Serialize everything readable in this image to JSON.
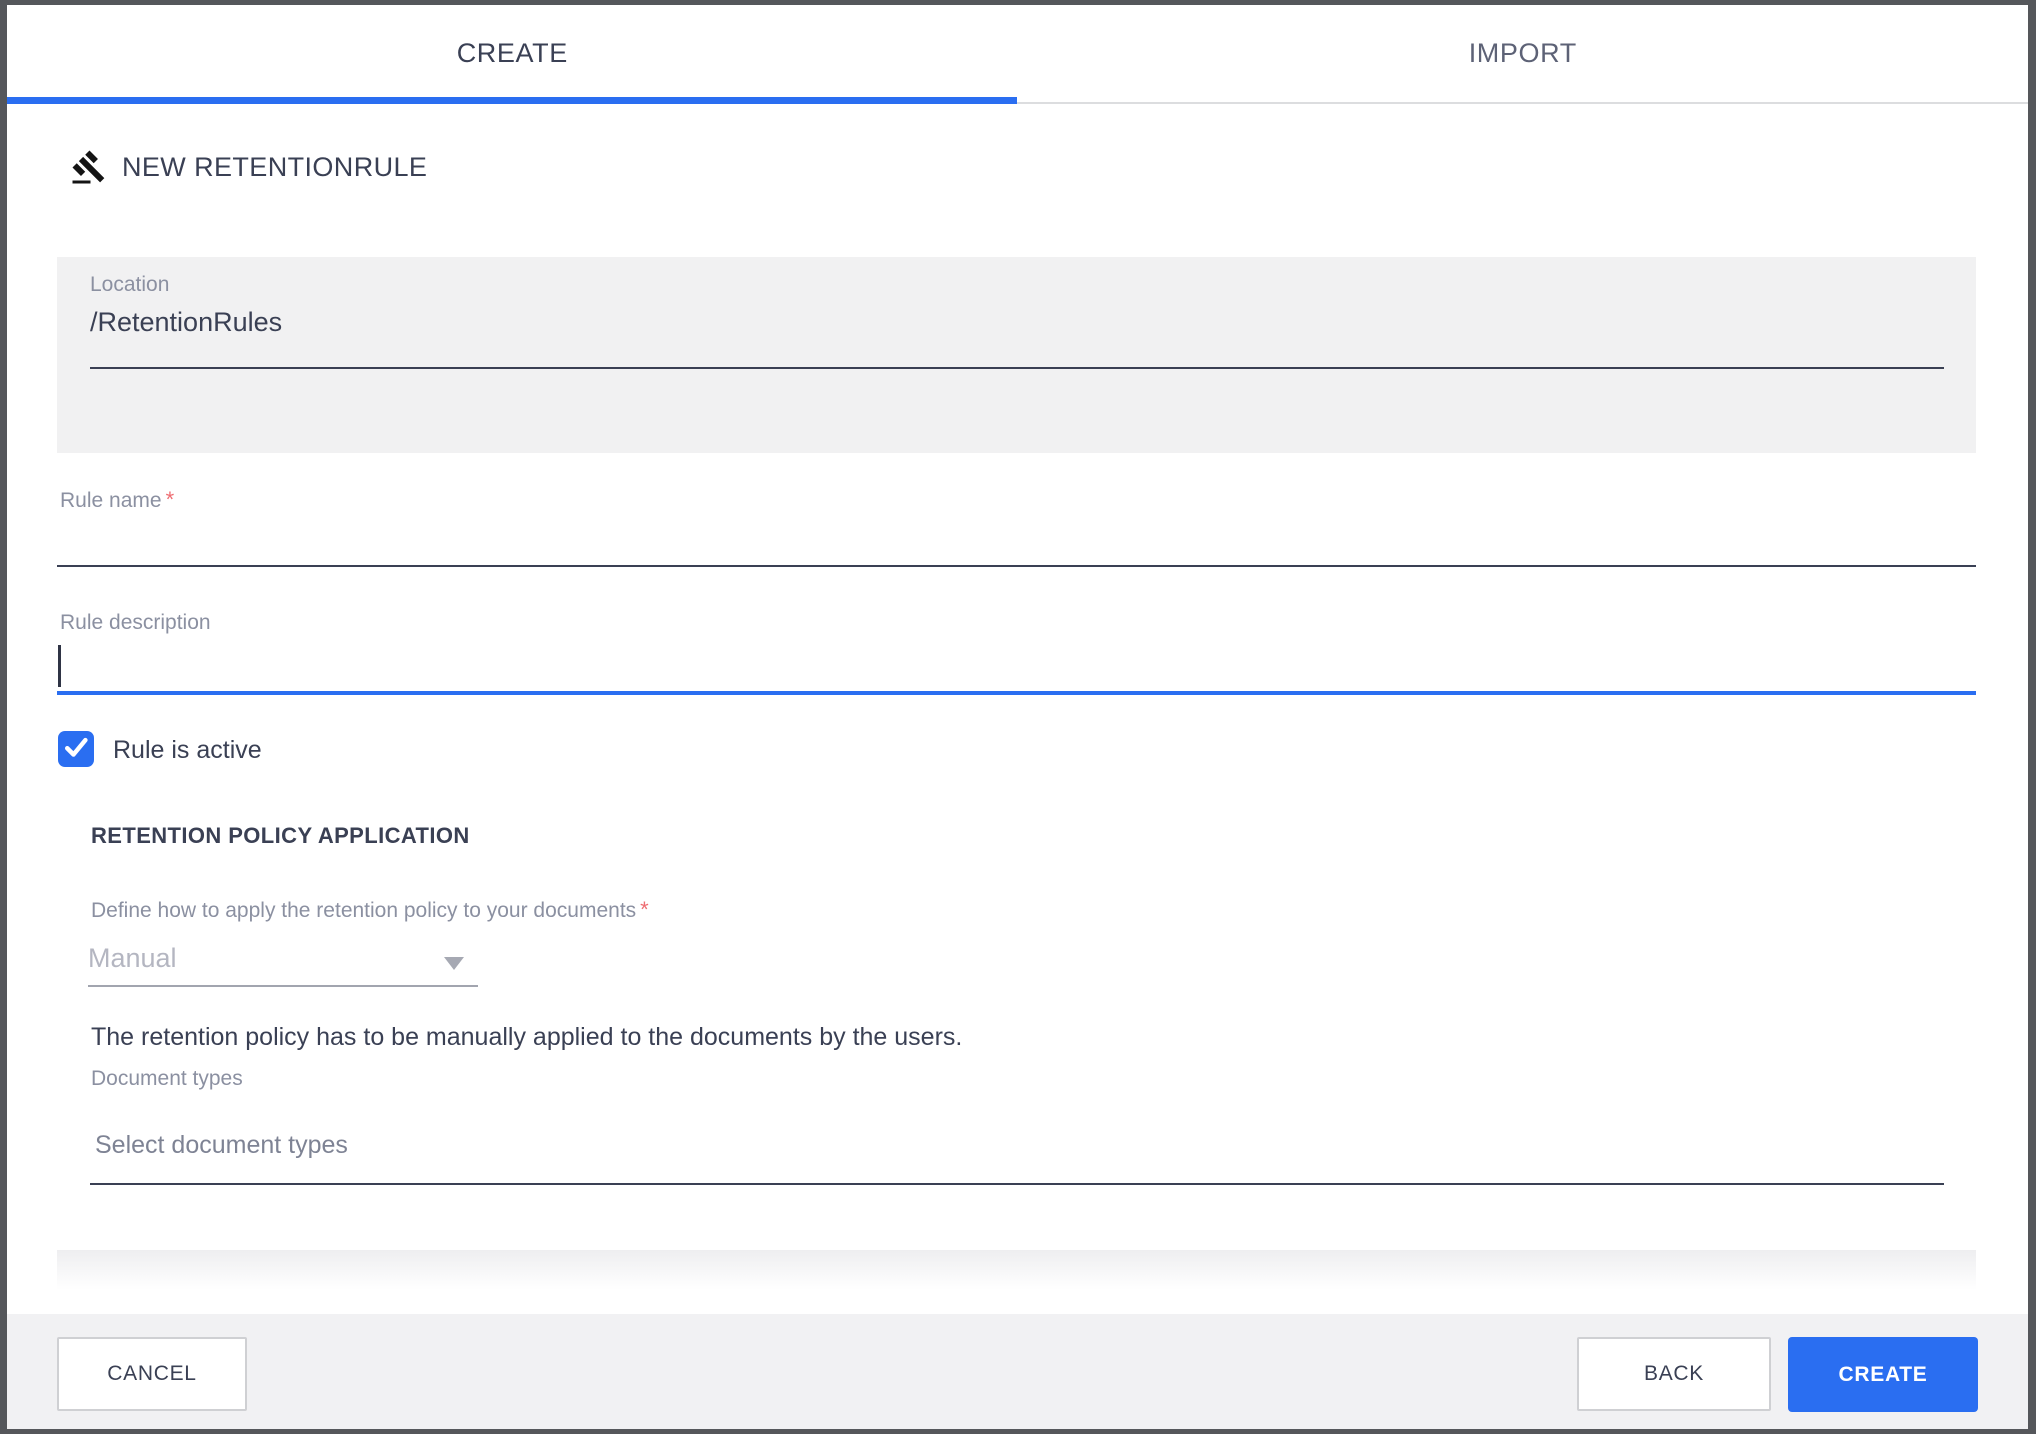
{
  "tabs": {
    "create_label": "CREATE",
    "import_label": "IMPORT"
  },
  "header": {
    "title": "NEW RETENTIONRULE",
    "icon": "gavel-icon"
  },
  "form": {
    "location": {
      "label": "Location",
      "value": "/RetentionRules"
    },
    "rule_name": {
      "label": "Rule name",
      "required_marker": "*",
      "value": ""
    },
    "rule_description": {
      "label": "Rule description",
      "value": ""
    },
    "rule_active": {
      "label": "Rule is active",
      "checked": true
    },
    "retention_policy": {
      "section_title": "RETENTION POLICY APPLICATION",
      "apply_mode_label": "Define how to apply the retention policy to your documents",
      "apply_mode_required_marker": "*",
      "apply_mode_value": "Manual",
      "apply_mode_hint": "The retention policy has to be manually applied to the documents by the users.",
      "document_types_label": "Document types",
      "document_types_placeholder": "Select document types"
    }
  },
  "footer": {
    "cancel_label": "CANCEL",
    "back_label": "BACK",
    "create_label": "CREATE"
  },
  "colors": {
    "accent_blue": "#2a6ef1",
    "dark_text": "#3a4054",
    "label_gray": "#8b90a1",
    "required_red": "#ee6d72"
  }
}
